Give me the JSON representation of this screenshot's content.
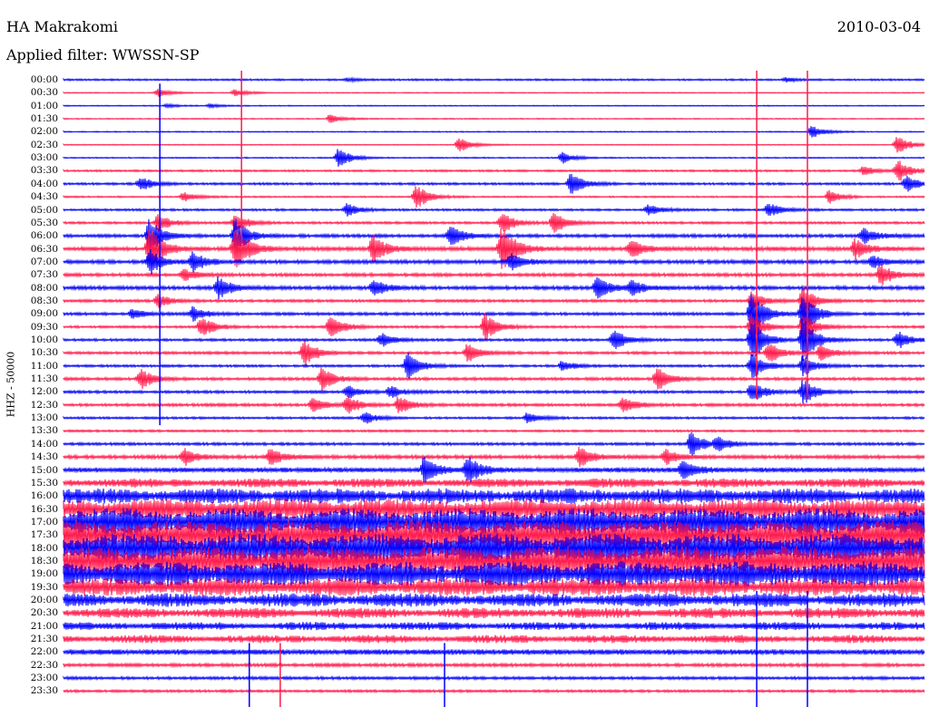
{
  "header": {
    "station": "HA Makrakomi",
    "filter_label": "Applied filter:",
    "filter_value": "WWSSN-SP",
    "date": "2010-03-04"
  },
  "colors": {
    "trace_a": "#0000ff",
    "trace_b": "#ff1a4b",
    "background": "#ffffff",
    "text": "#000000"
  },
  "chart_data": {
    "type": "line",
    "title": "HA Makrakomi",
    "subtitle": "Applied filter: WWSSN-SP",
    "date": "2010-03-04",
    "ylabel": "HHZ - 50000",
    "xlabel": "",
    "x_range_minutes": [
      0,
      30
    ],
    "row_labels": [
      "00:00",
      "00:30",
      "01:00",
      "01:30",
      "02:00",
      "02:30",
      "03:00",
      "03:30",
      "04:00",
      "04:30",
      "05:00",
      "05:30",
      "06:00",
      "06:30",
      "07:00",
      "07:30",
      "08:00",
      "08:30",
      "09:00",
      "09:30",
      "10:00",
      "10:30",
      "11:00",
      "11:30",
      "12:00",
      "12:30",
      "13:00",
      "13:30",
      "14:00",
      "14:30",
      "15:00",
      "15:30",
      "16:00",
      "16:30",
      "17:00",
      "17:30",
      "18:00",
      "18:30",
      "19:00",
      "19:30",
      "20:00",
      "20:30",
      "21:00",
      "21:30",
      "22:00",
      "22:30",
      "23:00",
      "23:30"
    ],
    "row_colors_alternate": [
      "#0000ff",
      "#ff1a4b"
    ],
    "noise_level": [
      1,
      0.6,
      0.6,
      0.6,
      0.6,
      0.6,
      0.7,
      1.1,
      1.3,
      0.9,
      1.2,
      1.3,
      1.8,
      2.2,
      2.0,
      1.8,
      2.0,
      1.5,
      1.6,
      1.3,
      1.4,
      1.5,
      1.3,
      1.6,
      1.5,
      1.6,
      1.2,
      1.2,
      1.5,
      2.0,
      2.6,
      4.0,
      6.5,
      9.0,
      12.0,
      13.0,
      13.0,
      13.0,
      11.0,
      8.0,
      6.0,
      4.5,
      3.5,
      3.5,
      3.0,
      1.8,
      1.6,
      1.4
    ],
    "events": [
      {
        "row": 0,
        "x": 0.33,
        "amp": 2
      },
      {
        "row": 0,
        "x": 0.84,
        "amp": 2
      },
      {
        "row": 1,
        "x": 0.11,
        "amp": 4
      },
      {
        "row": 1,
        "x": 0.2,
        "amp": 4
      },
      {
        "row": 2,
        "x": 0.12,
        "amp": 2
      },
      {
        "row": 2,
        "x": 0.17,
        "amp": 2
      },
      {
        "row": 3,
        "x": 0.31,
        "amp": 5
      },
      {
        "row": 4,
        "x": 0.87,
        "amp": 7
      },
      {
        "row": 5,
        "x": 0.46,
        "amp": 9
      },
      {
        "row": 5,
        "x": 0.97,
        "amp": 10
      },
      {
        "row": 6,
        "x": 0.32,
        "amp": 11
      },
      {
        "row": 6,
        "x": 0.58,
        "amp": 6
      },
      {
        "row": 7,
        "x": 0.97,
        "amp": 12
      },
      {
        "row": 7,
        "x": 0.93,
        "amp": 5
      },
      {
        "row": 8,
        "x": 0.09,
        "amp": 8
      },
      {
        "row": 8,
        "x": 0.59,
        "amp": 13
      },
      {
        "row": 8,
        "x": 0.98,
        "amp": 9
      },
      {
        "row": 9,
        "x": 0.41,
        "amp": 14
      },
      {
        "row": 9,
        "x": 0.14,
        "amp": 5
      },
      {
        "row": 9,
        "x": 0.89,
        "amp": 7
      },
      {
        "row": 10,
        "x": 0.33,
        "amp": 7
      },
      {
        "row": 10,
        "x": 0.82,
        "amp": 8
      },
      {
        "row": 10,
        "x": 0.68,
        "amp": 6
      },
      {
        "row": 11,
        "x": 0.57,
        "amp": 14
      },
      {
        "row": 11,
        "x": 0.51,
        "amp": 12
      },
      {
        "row": 11,
        "x": 0.2,
        "amp": 10
      },
      {
        "row": 11,
        "x": 0.11,
        "amp": 10
      },
      {
        "row": 12,
        "x": 0.1,
        "amp": 22
      },
      {
        "row": 12,
        "x": 0.2,
        "amp": 20
      },
      {
        "row": 12,
        "x": 0.45,
        "amp": 14
      },
      {
        "row": 12,
        "x": 0.93,
        "amp": 9
      },
      {
        "row": 13,
        "x": 0.1,
        "amp": 28
      },
      {
        "row": 13,
        "x": 0.2,
        "amp": 28
      },
      {
        "row": 13,
        "x": 0.36,
        "amp": 16
      },
      {
        "row": 13,
        "x": 0.51,
        "amp": 28
      },
      {
        "row": 13,
        "x": 0.66,
        "amp": 10
      },
      {
        "row": 13,
        "x": 0.92,
        "amp": 10
      },
      {
        "row": 14,
        "x": 0.15,
        "amp": 11
      },
      {
        "row": 14,
        "x": 0.1,
        "amp": 14
      },
      {
        "row": 14,
        "x": 0.52,
        "amp": 10
      },
      {
        "row": 14,
        "x": 0.94,
        "amp": 8
      },
      {
        "row": 15,
        "x": 0.14,
        "amp": 7
      },
      {
        "row": 15,
        "x": 0.95,
        "amp": 12
      },
      {
        "row": 16,
        "x": 0.18,
        "amp": 13
      },
      {
        "row": 16,
        "x": 0.36,
        "amp": 10
      },
      {
        "row": 16,
        "x": 0.62,
        "amp": 13
      },
      {
        "row": 16,
        "x": 0.66,
        "amp": 9
      },
      {
        "row": 17,
        "x": 0.11,
        "amp": 8
      },
      {
        "row": 17,
        "x": 0.8,
        "amp": 10
      },
      {
        "row": 17,
        "x": 0.86,
        "amp": 16
      },
      {
        "row": 18,
        "x": 0.08,
        "amp": 5
      },
      {
        "row": 18,
        "x": 0.15,
        "amp": 8
      },
      {
        "row": 18,
        "x": 0.8,
        "amp": 25
      },
      {
        "row": 18,
        "x": 0.86,
        "amp": 25
      },
      {
        "row": 19,
        "x": 0.16,
        "amp": 12
      },
      {
        "row": 19,
        "x": 0.31,
        "amp": 15
      },
      {
        "row": 19,
        "x": 0.49,
        "amp": 16
      },
      {
        "row": 19,
        "x": 0.8,
        "amp": 16
      },
      {
        "row": 19,
        "x": 0.86,
        "amp": 16
      },
      {
        "row": 20,
        "x": 0.37,
        "amp": 8
      },
      {
        "row": 20,
        "x": 0.64,
        "amp": 12
      },
      {
        "row": 20,
        "x": 0.8,
        "amp": 25
      },
      {
        "row": 20,
        "x": 0.86,
        "amp": 25
      },
      {
        "row": 20,
        "x": 0.97,
        "amp": 10
      },
      {
        "row": 21,
        "x": 0.28,
        "amp": 15
      },
      {
        "row": 21,
        "x": 0.47,
        "amp": 10
      },
      {
        "row": 21,
        "x": 0.82,
        "amp": 12
      },
      {
        "row": 21,
        "x": 0.88,
        "amp": 10
      },
      {
        "row": 22,
        "x": 0.4,
        "amp": 15
      },
      {
        "row": 22,
        "x": 0.58,
        "amp": 6
      },
      {
        "row": 22,
        "x": 0.8,
        "amp": 15
      },
      {
        "row": 22,
        "x": 0.86,
        "amp": 12
      },
      {
        "row": 23,
        "x": 0.09,
        "amp": 11
      },
      {
        "row": 23,
        "x": 0.3,
        "amp": 13
      },
      {
        "row": 23,
        "x": 0.69,
        "amp": 13
      },
      {
        "row": 24,
        "x": 0.33,
        "amp": 7
      },
      {
        "row": 24,
        "x": 0.38,
        "amp": 6
      },
      {
        "row": 24,
        "x": 0.8,
        "amp": 12
      },
      {
        "row": 24,
        "x": 0.86,
        "amp": 14
      },
      {
        "row": 25,
        "x": 0.29,
        "amp": 8
      },
      {
        "row": 25,
        "x": 0.33,
        "amp": 10
      },
      {
        "row": 25,
        "x": 0.39,
        "amp": 10
      },
      {
        "row": 25,
        "x": 0.65,
        "amp": 9
      },
      {
        "row": 26,
        "x": 0.35,
        "amp": 7
      },
      {
        "row": 26,
        "x": 0.54,
        "amp": 6
      },
      {
        "row": 28,
        "x": 0.73,
        "amp": 14
      },
      {
        "row": 28,
        "x": 0.76,
        "amp": 8
      },
      {
        "row": 29,
        "x": 0.14,
        "amp": 9
      },
      {
        "row": 29,
        "x": 0.24,
        "amp": 9
      },
      {
        "row": 29,
        "x": 0.6,
        "amp": 11
      },
      {
        "row": 29,
        "x": 0.7,
        "amp": 8
      },
      {
        "row": 30,
        "x": 0.42,
        "amp": 16
      },
      {
        "row": 30,
        "x": 0.47,
        "amp": 16
      },
      {
        "row": 30,
        "x": 0.72,
        "amp": 12
      }
    ],
    "spikes": [
      {
        "x": 0.112,
        "row_from": 1,
        "row_to": 26
      },
      {
        "x": 0.207,
        "row_from": 0,
        "row_to": 12
      },
      {
        "x": 0.216,
        "row_from": 44,
        "row_to": 48
      },
      {
        "x": 0.252,
        "row_from": 44,
        "row_to": 48
      },
      {
        "x": 0.443,
        "row_from": 44,
        "row_to": 48
      },
      {
        "x": 0.806,
        "row_from": 0,
        "row_to": 24
      },
      {
        "x": 0.806,
        "row_from": 40,
        "row_to": 48
      },
      {
        "x": 0.865,
        "row_from": 0,
        "row_to": 24
      },
      {
        "x": 0.865,
        "row_from": 40,
        "row_to": 48
      }
    ],
    "grid": false,
    "legend": "none"
  }
}
